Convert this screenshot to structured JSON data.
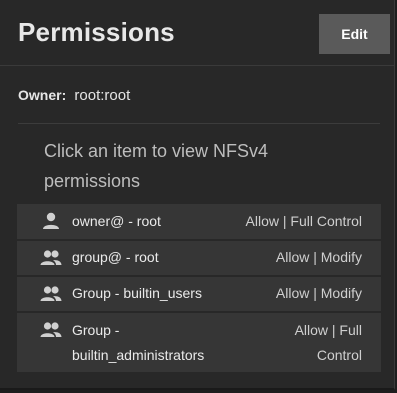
{
  "header": {
    "title": "Permissions",
    "edit_label": "Edit"
  },
  "owner": {
    "label": "Owner:",
    "value": "root:root"
  },
  "hint": "Click an item to view NFSv4 permissions",
  "acl_items": [
    {
      "who": "owner@ - root",
      "permission": "Allow | Full Control",
      "icon": "user-icon"
    },
    {
      "who": "group@ - root",
      "permission": "Allow | Modify",
      "icon": "group-icon"
    },
    {
      "who": "Group - builtin_users",
      "permission": "Allow | Modify",
      "icon": "group-icon"
    },
    {
      "who": "Group - builtin_administrators",
      "permission": "Allow | Full Control",
      "icon": "group-icon"
    }
  ]
}
